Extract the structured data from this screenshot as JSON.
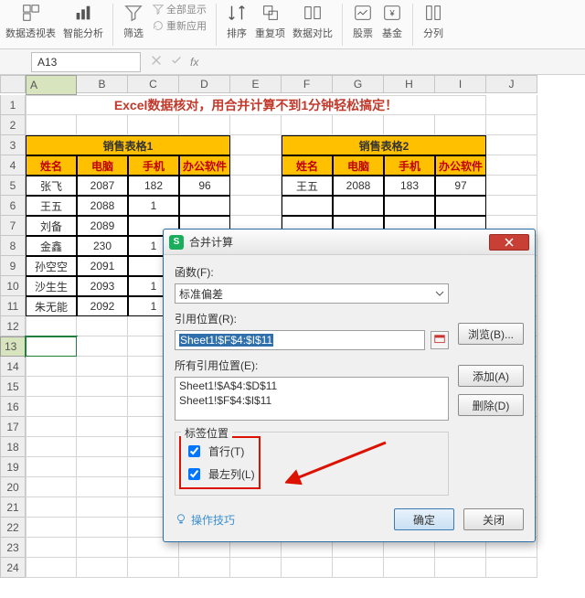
{
  "ribbon": {
    "pivot": "数据透视表",
    "smart": "智能分析",
    "filter": "筛选",
    "show_all": "全部显示",
    "reapply": "重新应用",
    "sort": "排序",
    "dup": "重复项",
    "compare": "数据对比",
    "stock": "股票",
    "fund": "基金",
    "split": "分列"
  },
  "namebox": "A13",
  "columns": [
    "A",
    "B",
    "C",
    "D",
    "E",
    "F",
    "G",
    "H",
    "I",
    "J"
  ],
  "rows": [
    "1",
    "2",
    "3",
    "4",
    "5",
    "6",
    "7",
    "8",
    "9",
    "10",
    "11",
    "12",
    "13",
    "14",
    "15",
    "16",
    "17",
    "18",
    "19",
    "20",
    "21",
    "22",
    "23",
    "24"
  ],
  "title": "Excel数据核对，用合并计算不到1分钟轻松搞定！",
  "table1_title": "销售表格1",
  "table2_title": "销售表格2",
  "headers": [
    "姓名",
    "电脑",
    "手机",
    "办公软件"
  ],
  "table1": [
    [
      "张飞",
      "2087",
      "182",
      "96"
    ],
    [
      "王五",
      "2088",
      "1",
      ""
    ],
    [
      "刘备",
      "2089",
      "",
      "",
      ""
    ],
    [
      "金鑫",
      "230",
      "1",
      ""
    ],
    [
      "孙空空",
      "2091",
      "",
      ""
    ],
    [
      "沙生生",
      "2093",
      "1",
      ""
    ],
    [
      "朱无能",
      "2092",
      "1",
      ""
    ]
  ],
  "table2": [
    [
      "王五",
      "2088",
      "183",
      "97"
    ]
  ],
  "dialog": {
    "title": "合并计算",
    "fn_label": "函数(F):",
    "fn_value": "标准偏差",
    "ref_label": "引用位置(R):",
    "ref_value": "Sheet1!$F$4:$I$11",
    "browse": "浏览(B)...",
    "all_refs_label": "所有引用位置(E):",
    "all_refs": [
      "Sheet1!$A$4:$D$11",
      "Sheet1!$F$4:$I$11"
    ],
    "add": "添加(A)",
    "delete": "删除(D)",
    "group_title": "标签位置",
    "top_row": "首行(T)",
    "left_col": "最左列(L)",
    "tip": "操作技巧",
    "ok": "确定",
    "close": "关闭"
  },
  "chart_data": {
    "type": "table",
    "tables": [
      {
        "name": "销售表格1",
        "columns": [
          "姓名",
          "电脑",
          "手机",
          "办公软件"
        ],
        "rows": [
          {
            "姓名": "张飞",
            "电脑": 2087,
            "手机": 182,
            "办公软件": 96
          },
          {
            "姓名": "王五",
            "电脑": 2088
          },
          {
            "姓名": "刘备",
            "电脑": 2089
          },
          {
            "姓名": "金鑫",
            "电脑": 230
          },
          {
            "姓名": "孙空空",
            "电脑": 2091
          },
          {
            "姓名": "沙生生",
            "电脑": 2093
          },
          {
            "姓名": "朱无能",
            "电脑": 2092
          }
        ]
      },
      {
        "name": "销售表格2",
        "columns": [
          "姓名",
          "电脑",
          "手机",
          "办公软件"
        ],
        "rows": [
          {
            "姓名": "王五",
            "电脑": 2088,
            "手机": 183,
            "办公软件": 97
          }
        ]
      }
    ]
  }
}
